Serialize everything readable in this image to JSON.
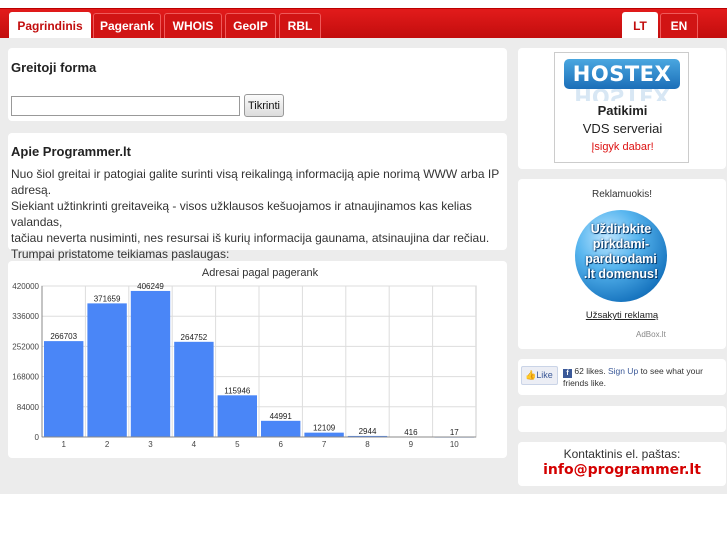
{
  "nav": {
    "tabs": [
      {
        "label": "Pagrindinis"
      },
      {
        "label": "Pagerank"
      },
      {
        "label": "WHOIS"
      },
      {
        "label": "GeoIP"
      },
      {
        "label": "RBL"
      }
    ],
    "lang": [
      {
        "label": "LT"
      },
      {
        "label": "EN"
      }
    ]
  },
  "quick_form": {
    "title": "Greitoji forma",
    "input_value": "",
    "button_label": "Tikrinti"
  },
  "about": {
    "title": "Apie Programmer.lt",
    "lines": [
      "Nuo šiol greitai ir patogiai galite surinti visą reikalingą informaciją apie norimą WWW arba IP adresą.",
      "Siekiant užtinkrinti greitaveiką - visos užklausos kešuojamos ir atnaujinamos kas kelias valandas,",
      "tačiau neverta nusiminti, nes resursai iš kurių informacija gaunama, atsinaujina dar rečiau.",
      "Trumpai pristatome teikiamas paslaugas:"
    ]
  },
  "chart_data": {
    "type": "bar",
    "title": "Adresai pagal pagerank",
    "categories": [
      "1",
      "2",
      "3",
      "4",
      "5",
      "6",
      "7",
      "8",
      "9",
      "10"
    ],
    "values": [
      266703,
      371659,
      406249,
      264752,
      115946,
      44991,
      12109,
      2944,
      416,
      17
    ],
    "yticks": [
      0,
      84000,
      168000,
      252000,
      336000,
      420000
    ],
    "ylim": [
      0,
      420000
    ],
    "grid": true,
    "bar_color": "#4a86f7"
  },
  "hostex_ad": {
    "logo": "HOSTEX",
    "line1": "Patikimi",
    "line2": "VDS serveriai",
    "line3": "Įsigyk dabar!"
  },
  "ad_block": {
    "title": "Reklamuokis!",
    "banner_lines": [
      "Uždirbkite",
      "pirkdami-",
      "parduodami",
      ".lt domenus!"
    ],
    "link": "Užsakyti reklamą",
    "credit": "AdBox.lt"
  },
  "facebook": {
    "like_label": "Like",
    "likes_text": "62 likes.",
    "signup_link": "Sign Up",
    "rest_text": "to see what your friends like."
  },
  "contact": {
    "label": "Kontaktinis el. paštas:",
    "email": "info@programmer.lt"
  }
}
